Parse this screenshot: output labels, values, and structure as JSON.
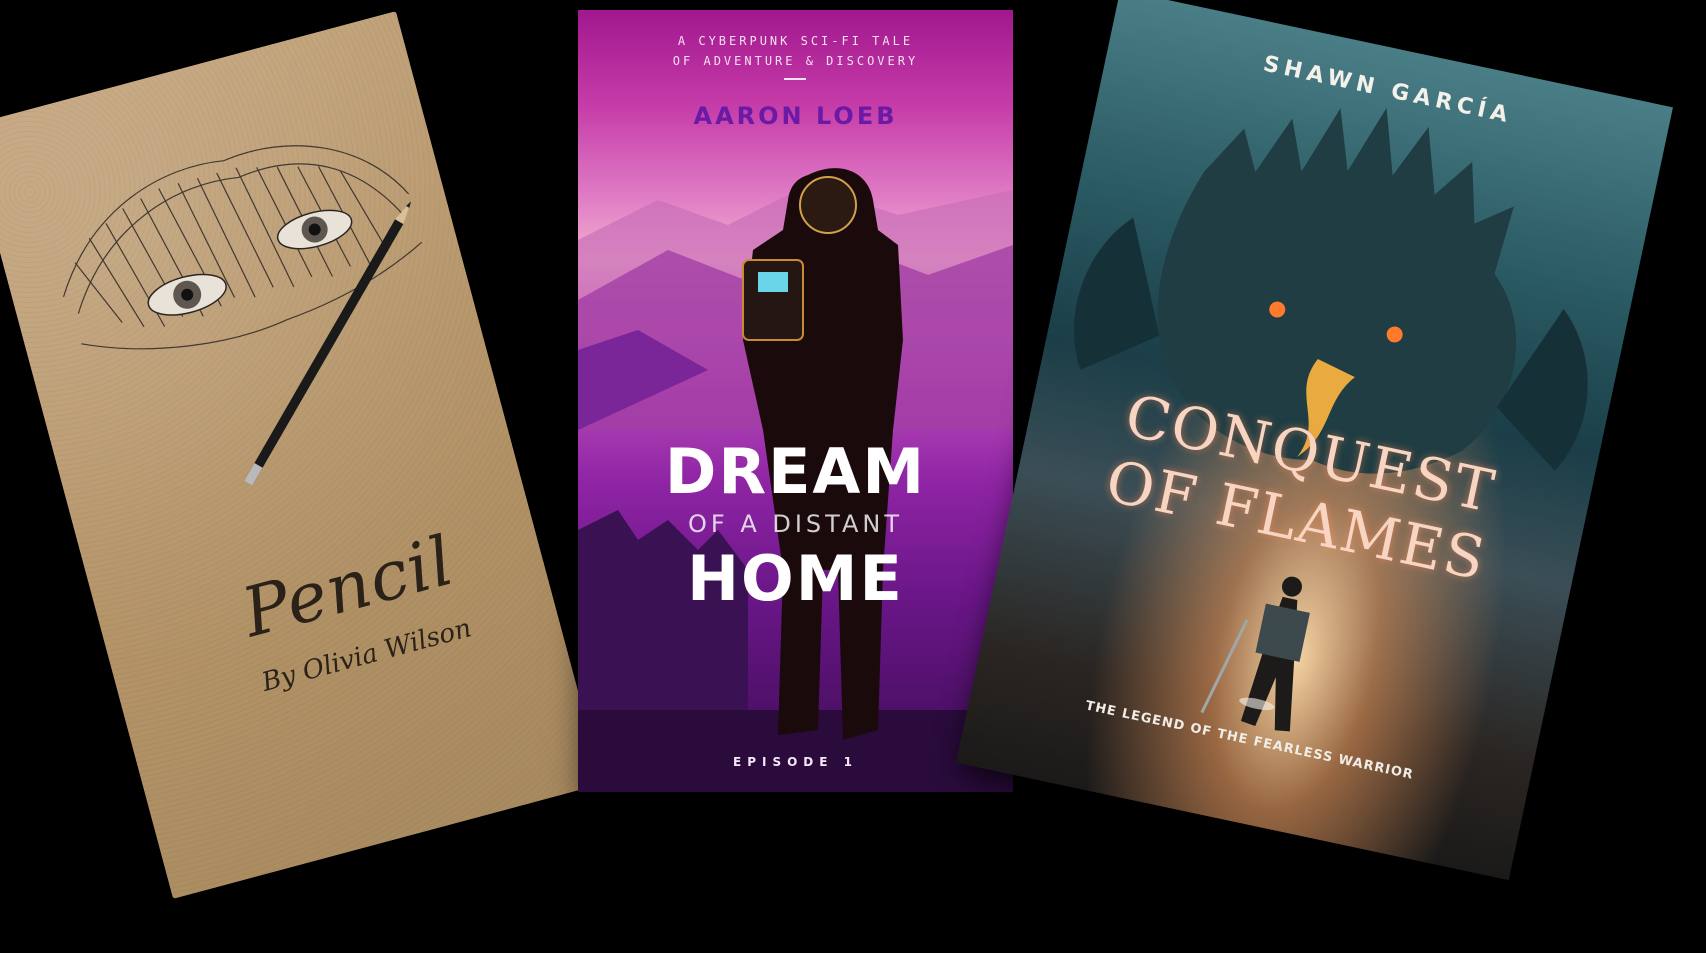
{
  "books": [
    {
      "title": "Pencil",
      "author": "By Olivia Wilson"
    },
    {
      "tagline_line1": "A CYBERPUNK SCI-FI TALE",
      "tagline_line2": "OF ADVENTURE & DISCOVERY",
      "author": "AARON LOEB",
      "title_line1": "DREAM",
      "title_line2": "OF A DISTANT",
      "title_line3": "HOME",
      "episode": "EPISODE 1"
    },
    {
      "author": "SHAWN GARCÍA",
      "title_line1": "CONQUEST",
      "title_line2": "OF FLAMES",
      "subtitle": "THE LEGEND OF THE FEARLESS WARRIOR"
    }
  ]
}
